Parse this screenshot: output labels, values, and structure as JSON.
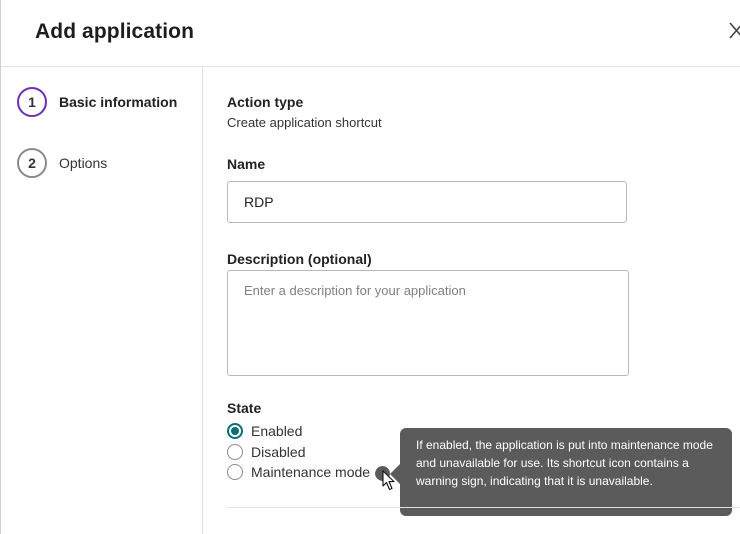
{
  "header": {
    "title": "Add application"
  },
  "steps": [
    {
      "number": "1",
      "label": "Basic information",
      "active": true
    },
    {
      "number": "2",
      "label": "Options",
      "active": false
    }
  ],
  "action_type": {
    "label": "Action type",
    "value": "Create application shortcut"
  },
  "name": {
    "label": "Name",
    "value": "RDP"
  },
  "description": {
    "label": "Description (optional)",
    "placeholder": "Enter a description for your application",
    "value": ""
  },
  "state": {
    "label": "State",
    "options": [
      {
        "label": "Enabled",
        "checked": true
      },
      {
        "label": "Disabled",
        "checked": false
      },
      {
        "label": "Maintenance mode",
        "checked": false
      }
    ]
  },
  "tooltip": {
    "text": "If enabled, the application is put into maintenance mode and unavailable for use. Its shortcut icon contains a warning sign, indicating that it is unavailable."
  },
  "colors": {
    "active_step": "#6b2fb5",
    "radio_checked": "#0b6e73",
    "tooltip_bg": "#5b5b5b"
  },
  "icons": {
    "close": "close-icon",
    "info": "info-icon",
    "cursor": "mouse-pointer-icon"
  }
}
